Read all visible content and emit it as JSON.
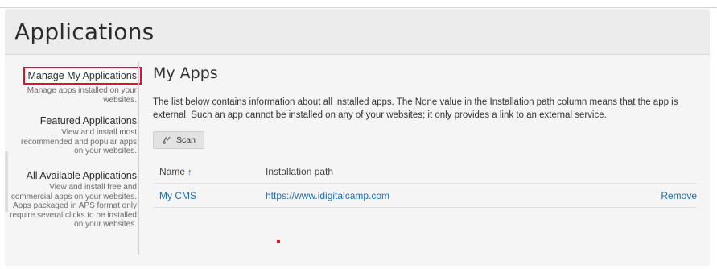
{
  "header": {
    "title": "Applications"
  },
  "sidebar": {
    "items": [
      {
        "title": "Manage My Applications",
        "desc": "Manage apps installed on your websites.",
        "selected": true
      },
      {
        "title": "Featured Applications",
        "desc": "View and install most recommended and popular apps on your websites."
      },
      {
        "title": "All Available Applications",
        "desc": "View and install free and commercial apps on your websites. Apps packaged in APS format only require several clicks to be installed on your websites."
      }
    ]
  },
  "main": {
    "title": "My Apps",
    "description": "The list below contains information about all installed apps. The None value in the Installation path column means that the app is external. Such an app cannot be installed on any of your websites; it only provides a link to an external service.",
    "scan_button": "Scan",
    "table": {
      "columns": {
        "name": "Name",
        "path": "Installation path"
      },
      "rows": [
        {
          "name": "My CMS",
          "path": "https://www.idigitalcamp.com",
          "action": "Remove"
        }
      ]
    }
  },
  "colors": {
    "highlight": "#e0112b",
    "link": "#1f6fb0"
  }
}
